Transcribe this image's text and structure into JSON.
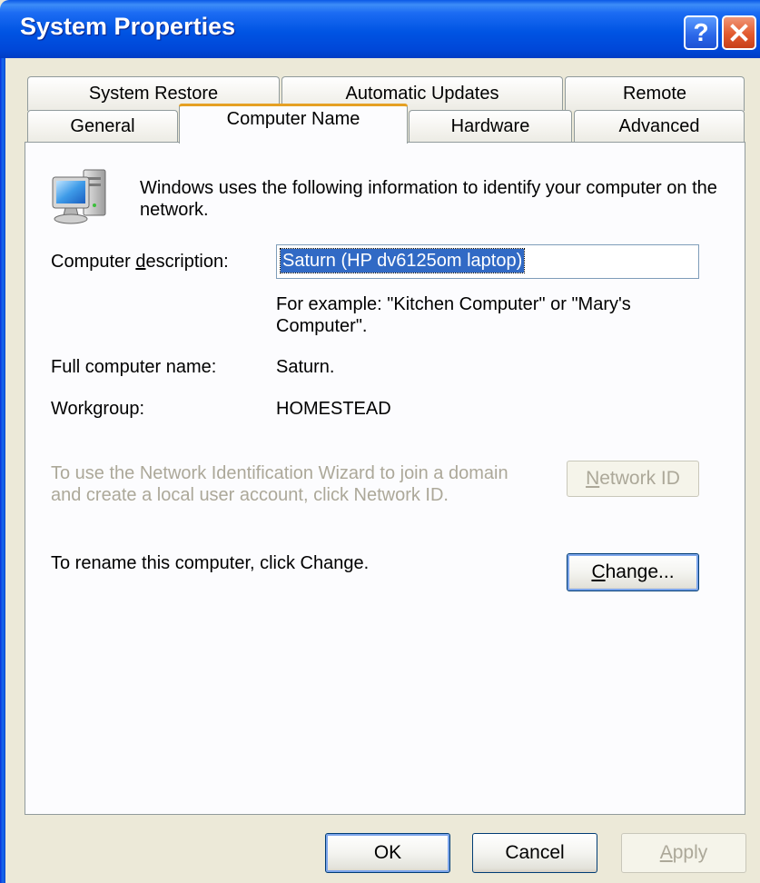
{
  "window": {
    "title": "System Properties",
    "help_glyph": "?",
    "close_icon": "close-icon"
  },
  "tabs": {
    "row_back": [
      {
        "label": "System Restore"
      },
      {
        "label": "Automatic Updates"
      },
      {
        "label": "Remote"
      }
    ],
    "row_front": [
      {
        "label": "General"
      },
      {
        "label": "Computer Name",
        "active": true
      },
      {
        "label": "Hardware"
      },
      {
        "label": "Advanced"
      }
    ]
  },
  "panel": {
    "intro_text": "Windows uses the following information to identify your computer on the network.",
    "description_label_pre": "Computer ",
    "description_label_accel": "d",
    "description_label_post": "escription:",
    "description_value": "Saturn (HP dv6125om laptop)",
    "example_text": "For example: \"Kitchen Computer\" or \"Mary's Computer\".",
    "full_name_label": "Full computer name:",
    "full_name_value": "Saturn.",
    "workgroup_label": "Workgroup:",
    "workgroup_value": "HOMESTEAD",
    "network_wizard_text": "To use the Network Identification Wizard to join a domain and create a local user account, click Network ID.",
    "network_id_accel": "N",
    "network_id_rest": "etwork ID",
    "rename_text": "To rename this computer, click Change.",
    "change_accel": "C",
    "change_rest": "hange..."
  },
  "buttons": {
    "ok": "OK",
    "cancel": "Cancel",
    "apply_accel": "A",
    "apply_rest": "pply"
  },
  "colors": {
    "titlebar": "#0054E3",
    "dialog_bg": "#ECE9D8",
    "active_tab_accent": "#FFC83C",
    "selection": "#316AC5",
    "close_button": "#E25A2E"
  }
}
